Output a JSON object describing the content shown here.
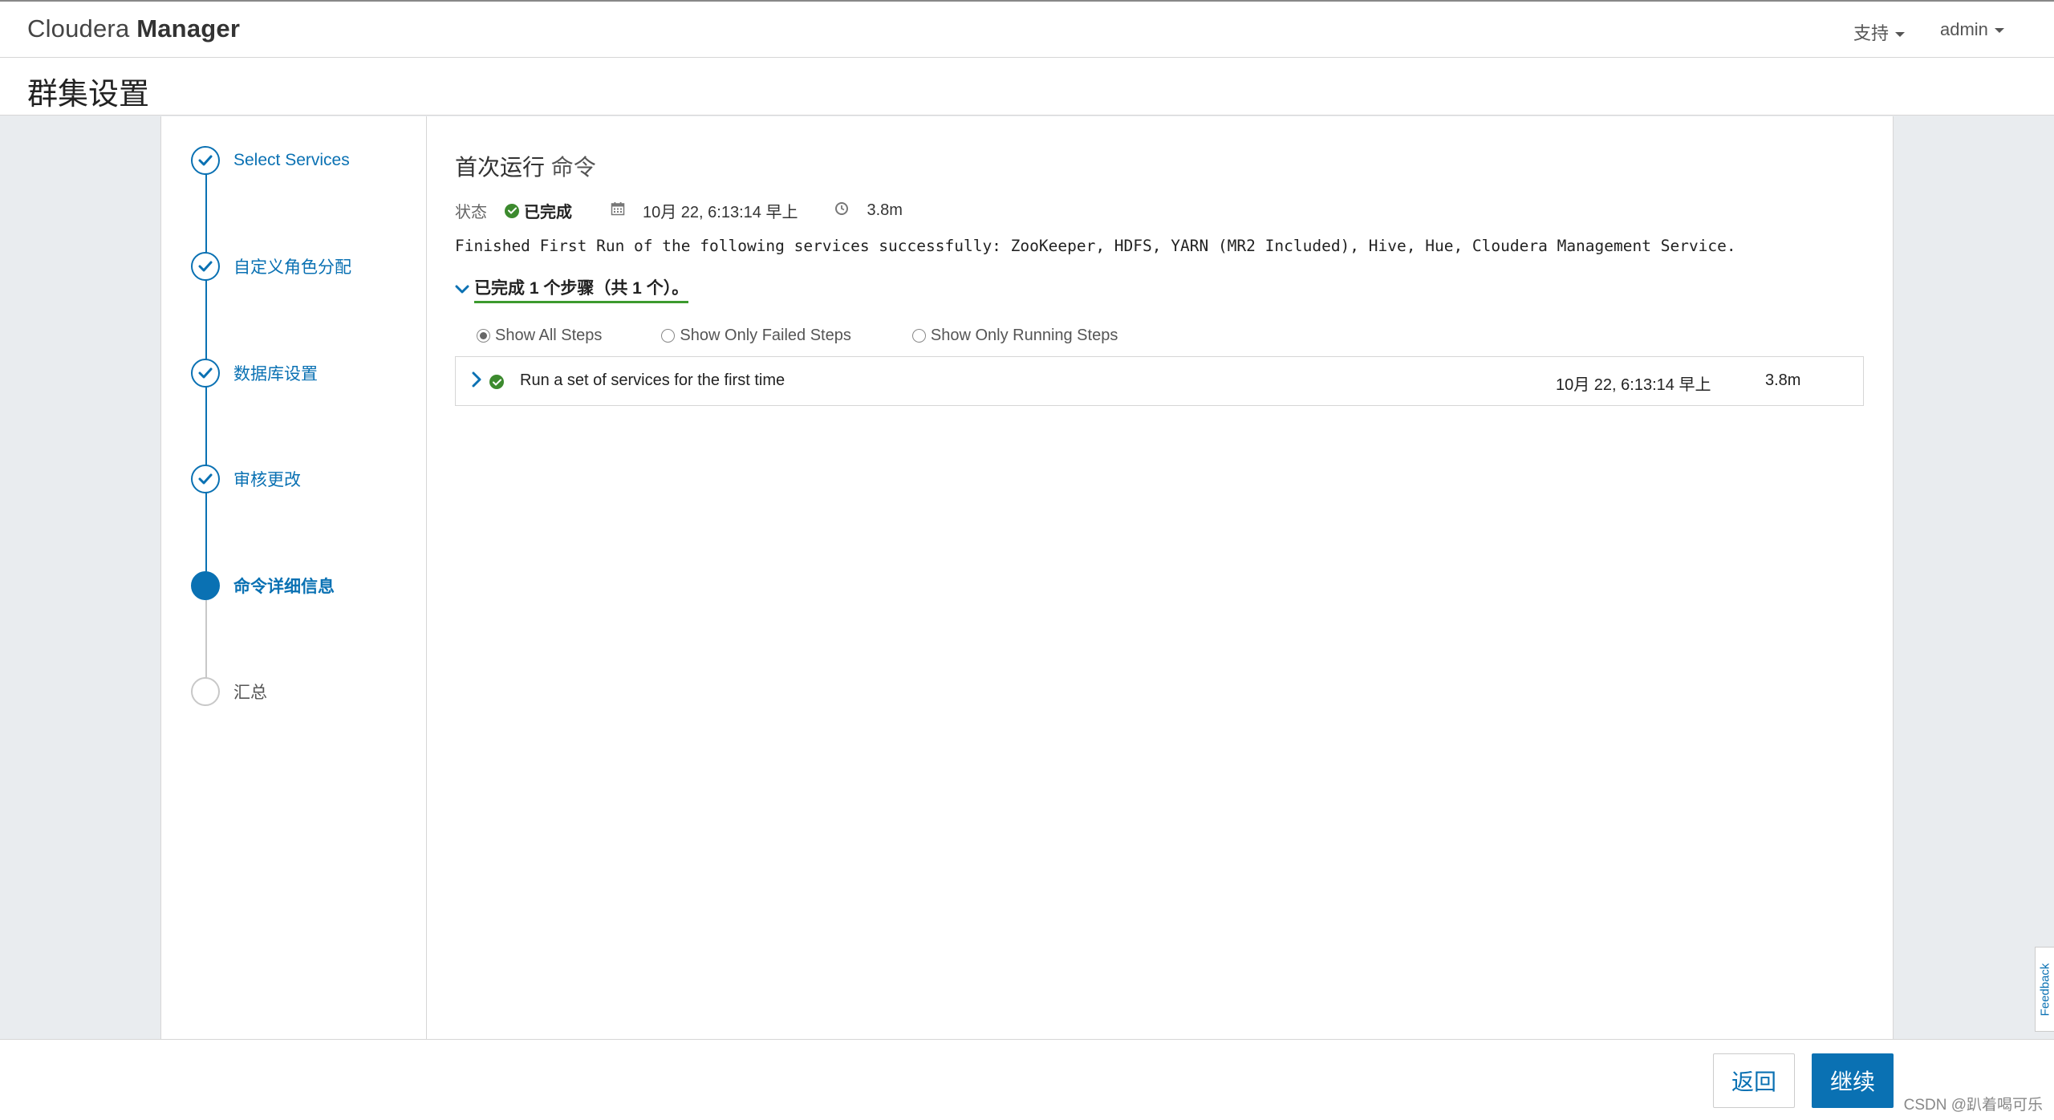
{
  "app": {
    "brand_light": "Cloudera ",
    "brand_bold": "Manager",
    "nav_support": "支持",
    "nav_user": "admin"
  },
  "page": {
    "title": "群集设置"
  },
  "wizard": {
    "steps": [
      {
        "label": "Select Services",
        "state": "done"
      },
      {
        "label": "自定义角色分配",
        "state": "done"
      },
      {
        "label": "数据库设置",
        "state": "done"
      },
      {
        "label": "审核更改",
        "state": "done"
      },
      {
        "label": "命令详细信息",
        "state": "active"
      },
      {
        "label": "汇总",
        "state": "pending"
      }
    ]
  },
  "command": {
    "title": "首次运行",
    "title_suffix": "命令",
    "status_label": "状态",
    "status_value": "已完成",
    "date": "10月 22, 6:13:14 早上",
    "duration": "3.8m",
    "message": "Finished First Run of the following services successfully: ZooKeeper, HDFS, YARN (MR2 Included), Hive, Hue, Cloudera Management Service.",
    "summary": "已完成 1 个步骤（共 1 个）。",
    "filters": [
      {
        "label": "Show All Steps",
        "selected": true
      },
      {
        "label": "Show Only Failed Steps",
        "selected": false
      },
      {
        "label": "Show Only Running Steps",
        "selected": false
      }
    ],
    "rows": [
      {
        "name": "Run a set of services for the first time",
        "date": "10月 22, 6:13:14 早上",
        "duration": "3.8m"
      }
    ]
  },
  "footer": {
    "back_label": "返回",
    "continue_label": "继续",
    "watermark": "CSDN @趴着喝可乐",
    "feedback_label": "Feedback"
  },
  "colors": {
    "accent": "#0a71b3",
    "success": "#3c8a2e",
    "underline": "#3c9a2e"
  }
}
